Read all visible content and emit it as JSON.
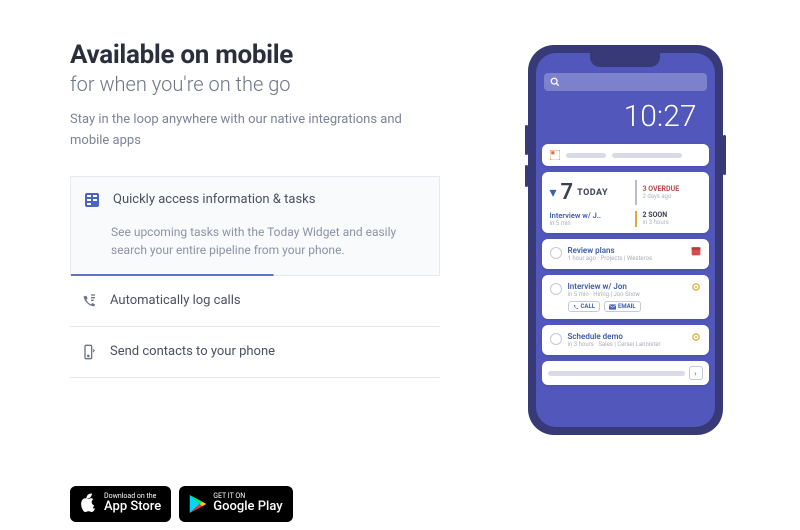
{
  "heading": "Available on mobile",
  "subheading": "for when you're on the go",
  "intro": "Stay in the loop anywhere with our native integrations and mobile apps",
  "accordion": [
    {
      "title": "Quickly access information & tasks",
      "body": "See upcoming tasks with the Today Widget and easily search your entire pipeline from your phone.",
      "active": true
    },
    {
      "title": "Automatically log calls",
      "active": false
    },
    {
      "title": "Send contacts to your phone",
      "active": false
    }
  ],
  "badges": {
    "apple": {
      "small": "Download on the",
      "big": "App Store"
    },
    "google": {
      "small": "GET IT ON",
      "big": "Google Play"
    }
  },
  "phone": {
    "clock": "10:27",
    "today": {
      "count": "7",
      "label": "TODAY",
      "overdue": {
        "count": "3",
        "label": "OVERDUE",
        "sub": "2 days ago"
      },
      "soon": {
        "count": "2",
        "label": "SOON",
        "sub": "in 3 hours"
      }
    },
    "interview_left": {
      "title": "Interview w/ J..",
      "sub": "in 5 min"
    },
    "tasks": [
      {
        "title": "Review plans",
        "sub": "1 hour ago · Projects | Westeros",
        "icon": "calendar",
        "icon_color": "#d94c4c"
      },
      {
        "title": "Interview w/ Jon",
        "sub": "in 5 min · Hiring | Jon Snow",
        "icon": "gear",
        "icon_color": "#e0a838",
        "buttons": true
      },
      {
        "title": "Schedule demo",
        "sub": "in 3 hours · Sales | Cersei Lannister",
        "icon": "gear",
        "icon_color": "#e0a838"
      }
    ],
    "buttons": {
      "call": "CALL",
      "email": "EMAIL"
    }
  }
}
